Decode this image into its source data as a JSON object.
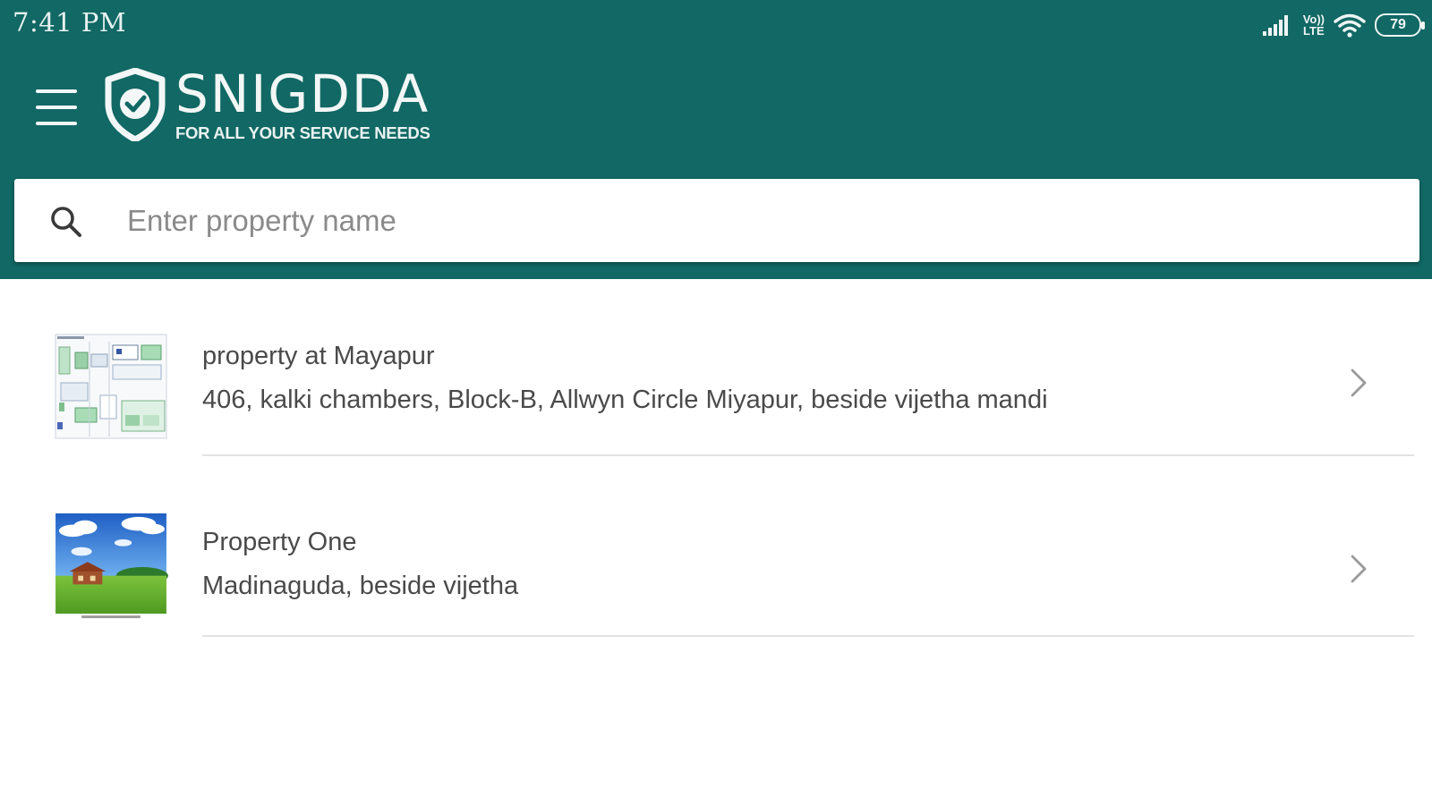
{
  "status_bar": {
    "time": "7:41 PM",
    "icons": [
      "signal-icon",
      "volte-icon",
      "wifi-icon",
      "battery-icon"
    ],
    "volte_top": "Vo))",
    "volte_bottom": "LTE",
    "battery_level": "79"
  },
  "app_bar": {
    "menu_icon": "hamburger-menu-icon",
    "logo_icon": "shield-check-icon",
    "brand_name": "SNIGDDA",
    "tagline": "FOR ALL YOUR SERVICE NEEDS"
  },
  "search": {
    "icon": "search-icon",
    "placeholder": "Enter property name",
    "value": ""
  },
  "properties": [
    {
      "title": "property at Mayapur",
      "address": "406, kalki chambers, Block-B, Allwyn Circle Miyapur, beside vijetha mandi",
      "thumbnail": "floor-plan-thumbnail"
    },
    {
      "title": "Property One",
      "address": "Madinaguda, beside vijetha",
      "thumbnail": "landscape-house-thumbnail"
    }
  ],
  "colors": {
    "primary": "#116864",
    "text": "#4a4a4a",
    "placeholder": "#8a8a8a",
    "divider": "#e3e3e3"
  }
}
